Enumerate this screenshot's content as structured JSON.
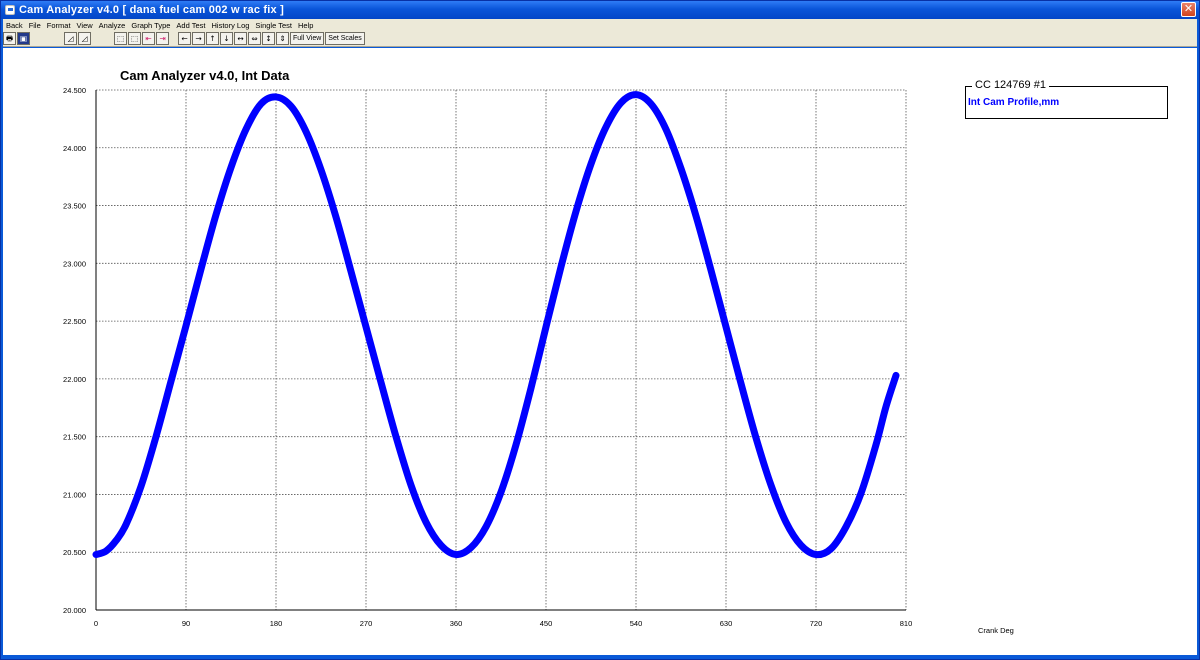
{
  "window": {
    "title": "Cam Analyzer v4.0  [ dana fuel cam 002 w rac fix ]",
    "close_glyph": "✕"
  },
  "menu": [
    "Back",
    "File",
    "Format",
    "View",
    "Analyze",
    "Graph Type",
    "Add Test",
    "History Log",
    "Single Test",
    "Help"
  ],
  "toolbar": {
    "groups": [
      [
        {
          "icon": "printer-icon",
          "glyph": "🖶"
        },
        {
          "icon": "save-disk-icon",
          "glyph": "▣",
          "style": "dark"
        }
      ],
      [
        {
          "icon": "graph-a-icon",
          "glyph": "◿"
        },
        {
          "icon": "graph-b-icon",
          "glyph": "◿"
        }
      ],
      [
        {
          "icon": "chart-zoom-icon",
          "glyph": "⬚"
        },
        {
          "icon": "chart-fit-icon",
          "glyph": "⬚"
        },
        {
          "icon": "prev-test-icon",
          "glyph": "⇤",
          "style": "pinkish"
        },
        {
          "icon": "next-test-icon",
          "glyph": "⇥",
          "style": "pinkish"
        }
      ],
      [
        {
          "icon": "scroll-left-icon",
          "glyph": "←"
        },
        {
          "icon": "scroll-right-icon",
          "glyph": "→"
        },
        {
          "icon": "scroll-up-icon",
          "glyph": "↑"
        },
        {
          "icon": "scroll-down-icon",
          "glyph": "↓"
        },
        {
          "icon": "expand-x-icon",
          "glyph": "↔"
        },
        {
          "icon": "shrink-x-icon",
          "glyph": "⇔"
        },
        {
          "icon": "expand-y-icon",
          "glyph": "↕"
        },
        {
          "icon": "shrink-y-icon",
          "glyph": "⇕"
        }
      ]
    ],
    "full_view_label": "Full View",
    "set_scales_label": "Set Scales"
  },
  "legend": {
    "title": "CC 124769 #1",
    "entry": "Int Cam Profile,mm",
    "entry_color": "#0000ff"
  },
  "chart_data": {
    "type": "line",
    "title": "Cam Analyzer v4.0,   Int Data",
    "xlabel": "Crank Deg",
    "ylabel": "",
    "xlim": [
      0,
      810
    ],
    "ylim": [
      20.0,
      24.5
    ],
    "x_ticks": [
      "0",
      "90",
      "180",
      "270",
      "360",
      "450",
      "540",
      "630",
      "720",
      "810"
    ],
    "y_ticks": [
      "24.500",
      "24.000",
      "23.500",
      "23.000",
      "22.500",
      "22.000",
      "21.500",
      "21.000",
      "20.500",
      "20.000"
    ],
    "grid": true,
    "series": [
      {
        "name": "Int Cam Profile,mm",
        "color": "#0000ff",
        "x": [
          0,
          10,
          20,
          30,
          45,
          60,
          75,
          90,
          105,
          120,
          135,
          150,
          165,
          180,
          195,
          210,
          225,
          240,
          255,
          270,
          285,
          300,
          315,
          330,
          345,
          360,
          375,
          390,
          405,
          420,
          435,
          450,
          465,
          480,
          495,
          510,
          525,
          540,
          555,
          570,
          585,
          600,
          615,
          630,
          645,
          660,
          675,
          690,
          705,
          720,
          735,
          750,
          765,
          780,
          790,
          800
        ],
        "y": [
          20.48,
          20.51,
          20.6,
          20.74,
          21.07,
          21.5,
          21.98,
          22.46,
          22.95,
          23.42,
          23.83,
          24.16,
          24.38,
          24.44,
          24.36,
          24.14,
          23.81,
          23.4,
          22.93,
          22.45,
          21.97,
          21.5,
          21.08,
          20.76,
          20.56,
          20.48,
          20.54,
          20.72,
          21.02,
          21.43,
          21.92,
          22.45,
          22.97,
          23.45,
          23.86,
          24.18,
          24.39,
          24.46,
          24.38,
          24.16,
          23.82,
          23.41,
          22.94,
          22.45,
          21.96,
          21.49,
          21.08,
          20.76,
          20.56,
          20.48,
          20.53,
          20.72,
          21.01,
          21.43,
          21.76,
          22.03
        ]
      }
    ]
  }
}
